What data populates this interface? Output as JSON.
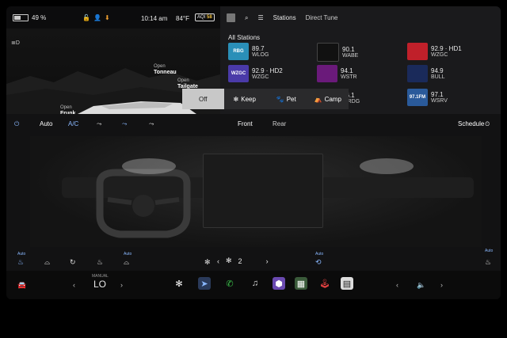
{
  "status": {
    "battery_percent": 49,
    "battery_label": "49 %",
    "time": "10:14 am",
    "temperature": "84°F",
    "aqi_label": "AQI",
    "aqi_value": "58"
  },
  "car": {
    "tonneau": {
      "action": "Open",
      "name": "Tonneau"
    },
    "tailgate": {
      "action": "Open",
      "name": "Tailgate"
    },
    "frunk": {
      "action": "Open",
      "name": "Frunk"
    }
  },
  "media": {
    "tab_stations": "Stations",
    "tab_direct_tune": "Direct Tune",
    "section_title": "All Stations",
    "stations": [
      {
        "logo": "RBG",
        "freq": "89.7",
        "call": "WLOG",
        "color": "#2a8fb8"
      },
      {
        "logo": "",
        "freq": "90.1",
        "call": "WABE",
        "color": "#111111"
      },
      {
        "logo": "",
        "freq": "92.9 · HD1",
        "call": "WZGC",
        "color": "#c0202a"
      },
      {
        "logo": "WZGC",
        "freq": "92.9 · HD2",
        "call": "WZGC",
        "color": "#4a3aa8"
      },
      {
        "logo": "",
        "freq": "94.1",
        "call": "WSTR",
        "color": "#6a1a7a"
      },
      {
        "logo": "",
        "freq": "94.9",
        "call": "BULL",
        "color": "#1a2a5a"
      },
      {
        "logo": "",
        "freq": "96.1",
        "call": "WRDG",
        "color": "#1a1a1a"
      },
      {
        "logo": "97.1FM",
        "freq": "97.1",
        "call": "WSRV",
        "color": "#2a5a9a"
      }
    ]
  },
  "modes": {
    "off": "Off",
    "keep": "Keep",
    "pet": "Pet",
    "camp": "Camp"
  },
  "climate": {
    "auto": "Auto",
    "ac": "A/C",
    "front": "Front",
    "rear": "Rear",
    "schedule": "Schedule",
    "fan_speed": "2",
    "auto_small": "Auto"
  },
  "dock": {
    "manual_label": "MANUAL",
    "temp_label": "LO"
  },
  "colors": {
    "accent": "#8ab8ff",
    "aqi": "#f0c040",
    "phone": "#3ac24a"
  }
}
